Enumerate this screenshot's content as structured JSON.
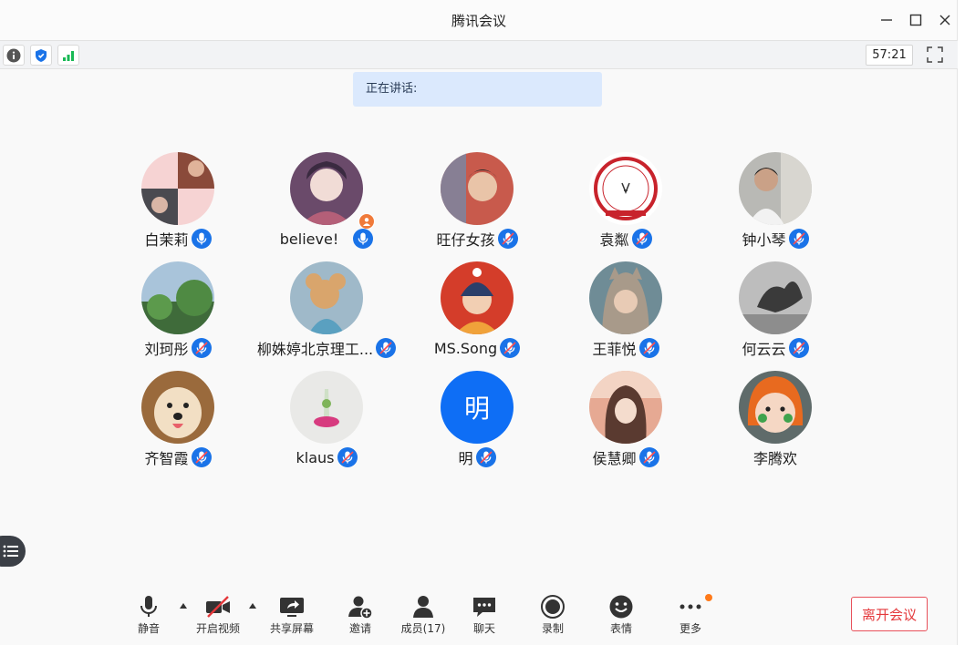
{
  "window": {
    "title": "腾讯会议"
  },
  "infobar": {
    "timer": "57:21"
  },
  "speaking": {
    "label": "正在讲话:"
  },
  "participants": [
    {
      "name": "白茉莉"
    },
    {
      "name": "believe!"
    },
    {
      "name": "旺仔女孩"
    },
    {
      "name": "袁粼"
    },
    {
      "name": "钟小琴"
    },
    {
      "name": "刘珂彤"
    },
    {
      "name": "柳姝婷北京理工..."
    },
    {
      "name": "MS.Song"
    },
    {
      "name": "王菲悦"
    },
    {
      "name": "何云云"
    },
    {
      "name": "齐智霞"
    },
    {
      "name": "klaus"
    },
    {
      "name": "明",
      "avatar_text": "明"
    },
    {
      "name": "侯慧卿"
    },
    {
      "name": "李腾欢"
    }
  ],
  "toolbar": {
    "mute": "静音",
    "video": "开启视频",
    "share": "共享屏幕",
    "invite": "邀请",
    "members": "成员(17)",
    "chat": "聊天",
    "record": "录制",
    "emoji": "表情",
    "more": "更多",
    "leave": "离开会议"
  },
  "colors": {
    "accent": "#0e6ef5",
    "leave": "#e4393c",
    "badge": "#ff7a1a"
  }
}
